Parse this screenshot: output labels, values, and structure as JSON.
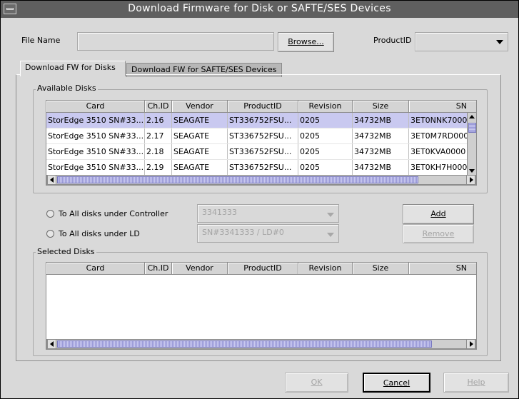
{
  "window": {
    "title": "Download Firmware for Disk or SAFTE/SES Devices"
  },
  "file_name": {
    "label": "File Name",
    "value": ""
  },
  "browse_button": "Browse...",
  "product_id": {
    "label": "ProductID",
    "value": ""
  },
  "tabs": [
    {
      "label": "Download FW for Disks",
      "active": true
    },
    {
      "label": "Download FW for SAFTE/SES Devices",
      "active": false
    }
  ],
  "available": {
    "title": "Available Disks",
    "columns": [
      "Card",
      "Ch.ID",
      "Vendor",
      "ProductID",
      "Revision",
      "Size",
      "SN"
    ],
    "rows": [
      [
        "StorEdge 3510 SN#33...",
        "2.16",
        "SEAGATE",
        "ST336752FSU...",
        "0205",
        "34732MB",
        "3ET0NNK7000"
      ],
      [
        "StorEdge 3510 SN#33...",
        "2.17",
        "SEAGATE",
        "ST336752FSU...",
        "0205",
        "34732MB",
        "3ET0M7RD000"
      ],
      [
        "StorEdge 3510 SN#33...",
        "2.18",
        "SEAGATE",
        "ST336752FSU...",
        "0205",
        "34732MB",
        "3ET0KVA0000"
      ],
      [
        "StorEdge 3510 SN#33...",
        "2.19",
        "SEAGATE",
        "ST336752FSU...",
        "0205",
        "34732MB",
        "3ET0KH7H000"
      ]
    ]
  },
  "options": {
    "controller": {
      "label": "To All disks under Controller",
      "value": "3341333"
    },
    "ld": {
      "label": "To All disks under LD",
      "value": "SN#3341333 / LD#0"
    }
  },
  "add_button": "Add",
  "remove_button": "Remove",
  "selected": {
    "title": "Selected Disks",
    "columns": [
      "Card",
      "Ch.ID",
      "Vendor",
      "ProductID",
      "Revision",
      "Size",
      "SN"
    ]
  },
  "footer": {
    "ok": "OK",
    "cancel": "Cancel",
    "help": "Help"
  },
  "colors": {
    "title_bar": "#5f5f5f",
    "selection": "#c9c9f0",
    "scroll_thumb": "#9a9ad8"
  }
}
